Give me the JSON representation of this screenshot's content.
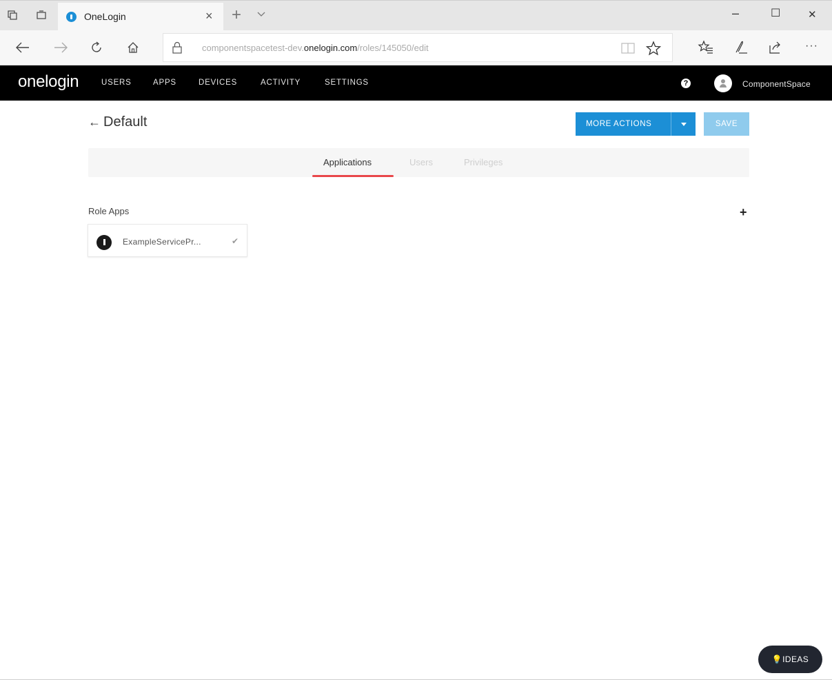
{
  "browser": {
    "tab_title": "OneLogin",
    "tab_close": "×",
    "new_tab": "+",
    "window_minimize": "–",
    "window_maximize": "☐",
    "window_close": "✕",
    "url_prefix": "componentspacetest-dev.",
    "url_domain": "onelogin.com",
    "url_path": "/roles/145050/edit"
  },
  "nav": {
    "logo": "onelogin",
    "links": [
      "USERS",
      "APPS",
      "DEVICES",
      "ACTIVITY",
      "SETTINGS"
    ],
    "help": "?",
    "username": "ComponentSpace"
  },
  "page": {
    "back_arrow": "←",
    "title": "Default",
    "more_actions_label": "MORE ACTIONS",
    "save_label": "SAVE",
    "tabs": [
      {
        "label": "Applications",
        "active": true
      },
      {
        "label": "Users",
        "active": false
      },
      {
        "label": "Privileges",
        "active": false
      }
    ],
    "section_label": "Role Apps",
    "add_label": "+",
    "apps": [
      {
        "name": "ExampleServicePr...",
        "check": "✔"
      }
    ]
  },
  "ideas_label": "IDEAS",
  "colors": {
    "accent": "#1c8fd6",
    "save_disabled": "#8fcbed",
    "tab_underline": "#e9474a",
    "nav_bg": "#000000"
  }
}
